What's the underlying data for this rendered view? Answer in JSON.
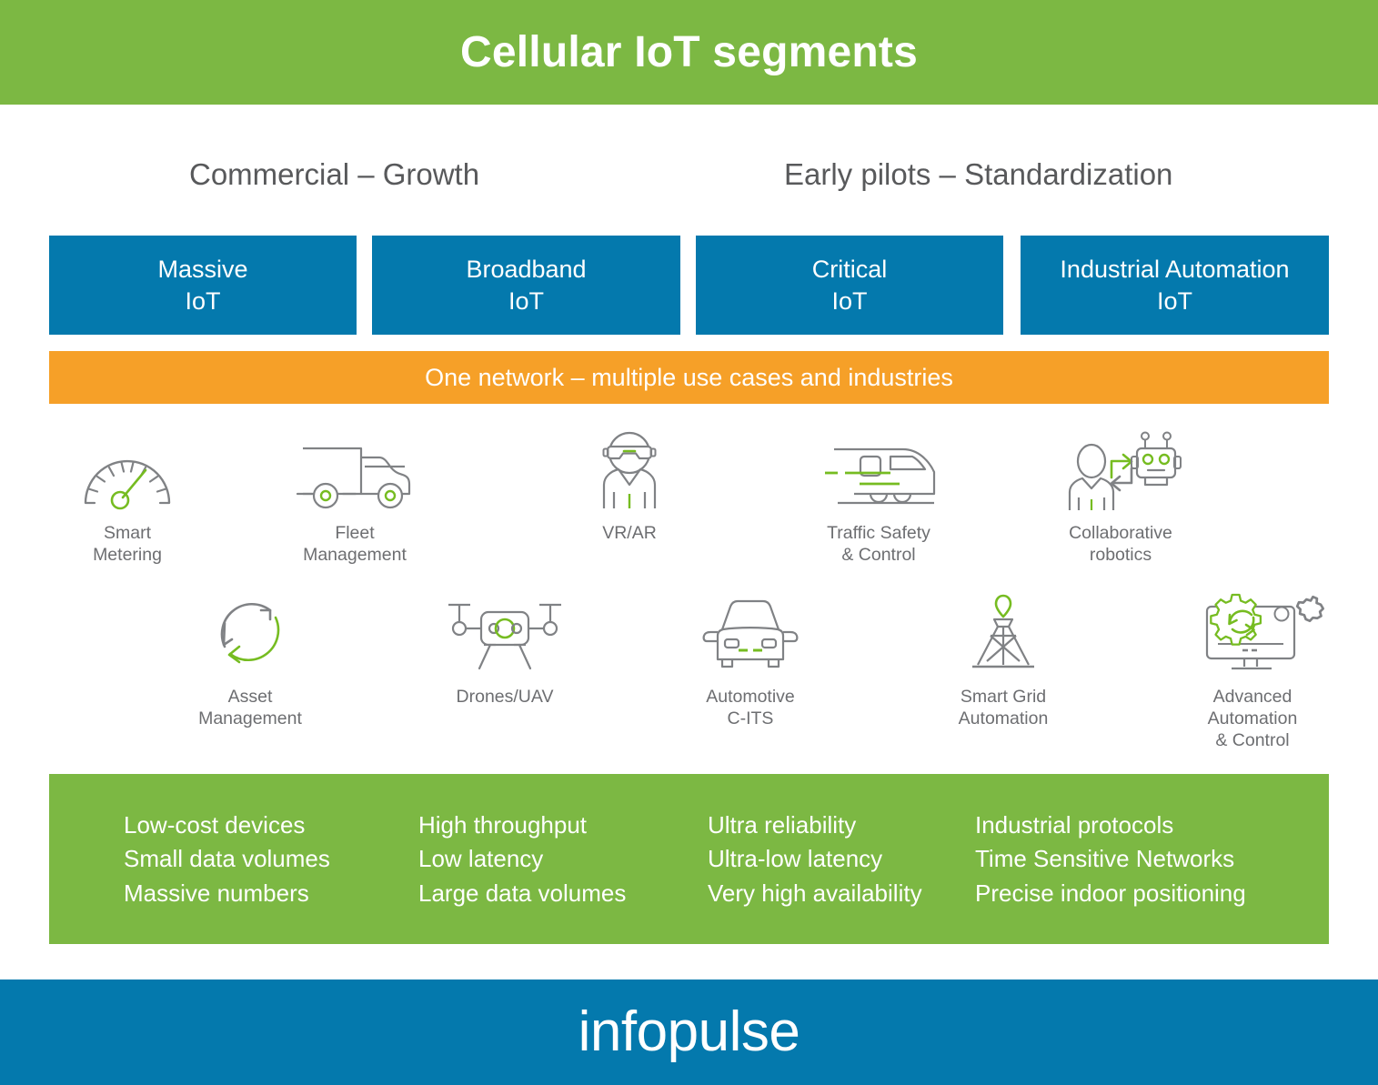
{
  "header": {
    "title": "Cellular IoT segments",
    "bg_color": "#7cb843"
  },
  "groups": [
    {
      "label": "Commercial – Growth"
    },
    {
      "label": "Early pilots – Standardization"
    }
  ],
  "segments": [
    {
      "line1": "Massive",
      "line2": "IoT"
    },
    {
      "line1": "Broadband",
      "line2": "IoT"
    },
    {
      "line1": "Critical",
      "line2": "IoT"
    },
    {
      "line1": "Industrial Automation",
      "line2": "IoT"
    }
  ],
  "segment_box_color": "#0479ad",
  "network_banner": {
    "text": "One network – multiple use cases and industries",
    "bg_color": "#f6a028"
  },
  "use_cases": [
    {
      "icon": "gauge-icon",
      "label": "Smart\nMetering"
    },
    {
      "icon": "truck-icon",
      "label": "Fleet\nManagement"
    },
    {
      "icon": "vr-headset-person-icon",
      "label": "VR/AR"
    },
    {
      "icon": "train-icon",
      "label": "Traffic Safety\n& Control"
    },
    {
      "icon": "human-robot-icon",
      "label": "Collaborative\nrobotics"
    },
    {
      "icon": "circular-arrows-icon",
      "label": "Asset\nManagement"
    },
    {
      "icon": "drone-icon",
      "label": "Drones/UAV"
    },
    {
      "icon": "car-front-icon",
      "label": "Automotive\nC-ITS"
    },
    {
      "icon": "power-pylon-icon",
      "label": "Smart Grid\nAutomation"
    },
    {
      "icon": "monitor-gears-icon",
      "label": "Advanced\nAutomation\n& Control"
    }
  ],
  "features": {
    "bg_color": "#7cb843",
    "columns": [
      {
        "items": [
          "Low-cost devices",
          "Small data volumes",
          "Massive numbers"
        ]
      },
      {
        "items": [
          "High throughput",
          "Low latency",
          "Large data volumes"
        ]
      },
      {
        "items": [
          "Ultra reliability",
          "Ultra-low latency",
          "Very high availability"
        ]
      },
      {
        "items": [
          "Industrial protocols",
          "Time Sensitive Networks",
          "Precise indoor positioning"
        ]
      }
    ]
  },
  "footer": {
    "logo_text": "infopulse",
    "bg_color": "#0479ad"
  },
  "palette": {
    "green": "#7cb843",
    "blue": "#0479ad",
    "orange": "#f6a028",
    "icon_gray": "#808285",
    "icon_green": "#76bc21",
    "text_gray": "#6d6e71"
  }
}
